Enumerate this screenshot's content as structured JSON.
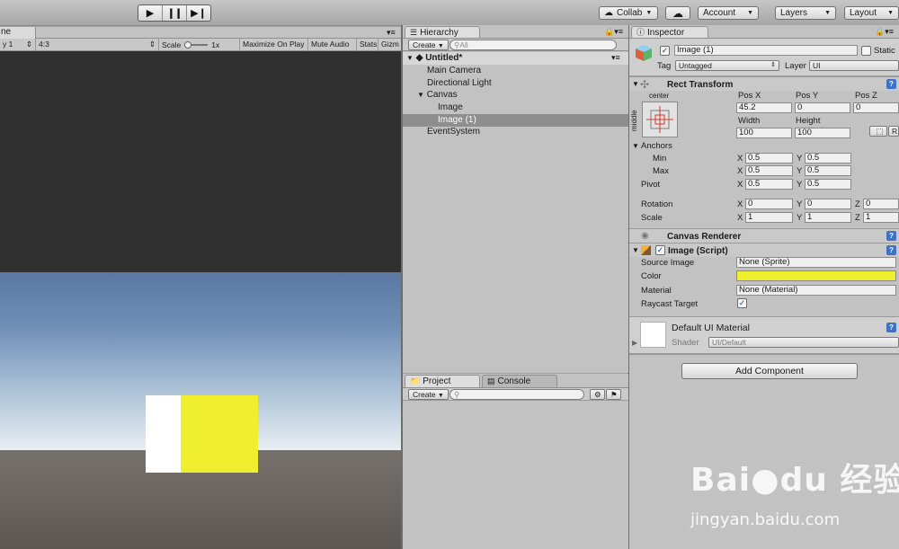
{
  "toolbar": {
    "play_icon": "play-icon",
    "pause_icon": "pause-icon",
    "step_icon": "step-icon",
    "collab_label": "Collab",
    "cloud_icon": "cloud-icon",
    "account_label": "Account",
    "layers_label": "Layers",
    "layout_label": "Layout"
  },
  "game": {
    "tab_label": "ne",
    "display_label": "y 1",
    "aspect_label": "4:3",
    "scale_label": "Scale",
    "scale_value": "1x",
    "maximize_label": "Maximize On Play",
    "mute_label": "Mute Audio",
    "stats_label": "Stats",
    "gizmos_label": "Gizm",
    "sprite_left_color": "#ffffff",
    "sprite_right_color": "#efef30"
  },
  "hierarchy": {
    "tab_label": "Hierarchy",
    "create_label": "Create",
    "search_placeholder": "All",
    "scene_name": "Untitled*",
    "items": [
      {
        "label": "Main Camera",
        "depth": 1,
        "selected": false
      },
      {
        "label": "Directional Light",
        "depth": 1,
        "selected": false
      },
      {
        "label": "Canvas",
        "depth": 1,
        "selected": false
      },
      {
        "label": "Image",
        "depth": 2,
        "selected": false
      },
      {
        "label": "Image (1)",
        "depth": 2,
        "selected": true
      },
      {
        "label": "EventSystem",
        "depth": 1,
        "selected": false
      }
    ]
  },
  "project": {
    "tab_label": "Project",
    "console_tab_label": "Console",
    "create_label": "Create"
  },
  "inspector": {
    "tab_label": "Inspector",
    "object_name": "Image (1)",
    "static_label": "Static",
    "tag_label": "Tag",
    "tag_value": "Untagged",
    "layer_label": "Layer",
    "layer_value": "UI",
    "rect_transform": {
      "title": "Rect Transform",
      "anchor_h": "center",
      "anchor_v": "middle",
      "pos_x_label": "Pos X",
      "pos_y_label": "Pos Y",
      "pos_z_label": "Pos Z",
      "pos_x": "45.2",
      "pos_y": "0",
      "pos_z": "0",
      "width_label": "Width",
      "height_label": "Height",
      "width": "100",
      "height": "100",
      "raw_btn": "R",
      "anchors_label": "Anchors",
      "min_label": "Min",
      "max_label": "Max",
      "min_x": "0.5",
      "min_y": "0.5",
      "max_x": "0.5",
      "max_y": "0.5",
      "pivot_label": "Pivot",
      "pivot_x": "0.5",
      "pivot_y": "0.5",
      "rotation_label": "Rotation",
      "rot_x": "0",
      "rot_y": "0",
      "rot_z": "0",
      "scale_label": "Scale",
      "scale_x": "1",
      "scale_y": "1",
      "scale_z": "1",
      "x": "X",
      "y": "Y",
      "z": "Z"
    },
    "canvas_renderer": {
      "title": "Canvas Renderer"
    },
    "image_script": {
      "title": "Image (Script)",
      "source_image_label": "Source Image",
      "source_image_value": "None (Sprite)",
      "color_label": "Color",
      "color_value": "#efef30",
      "material_label": "Material",
      "material_value": "None (Material)",
      "raycast_label": "Raycast Target"
    },
    "material": {
      "name": "Default UI Material",
      "shader_label": "Shader",
      "shader_value": "UI/Default"
    },
    "add_component_label": "Add Component"
  },
  "watermark": {
    "logo": "Bai●du 经验",
    "url": "jingyan.baidu.com"
  }
}
